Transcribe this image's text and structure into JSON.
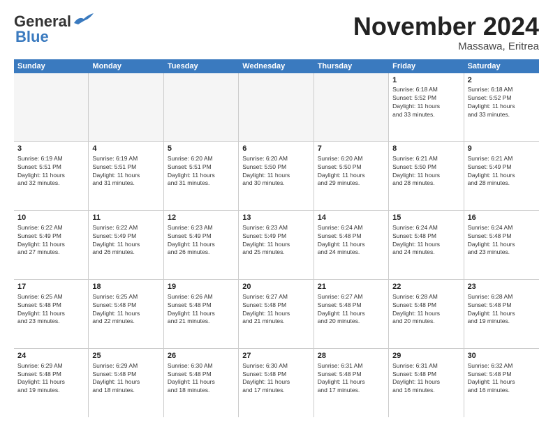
{
  "header": {
    "logo_general": "General",
    "logo_blue": "Blue",
    "month_title": "November 2024",
    "subtitle": "Massawa, Eritrea"
  },
  "days_of_week": [
    "Sunday",
    "Monday",
    "Tuesday",
    "Wednesday",
    "Thursday",
    "Friday",
    "Saturday"
  ],
  "weeks": [
    [
      {
        "day": "",
        "info": "",
        "empty": true
      },
      {
        "day": "",
        "info": "",
        "empty": true
      },
      {
        "day": "",
        "info": "",
        "empty": true
      },
      {
        "day": "",
        "info": "",
        "empty": true
      },
      {
        "day": "",
        "info": "",
        "empty": true
      },
      {
        "day": "1",
        "info": "Sunrise: 6:18 AM\nSunset: 5:52 PM\nDaylight: 11 hours\nand 33 minutes.",
        "empty": false
      },
      {
        "day": "2",
        "info": "Sunrise: 6:18 AM\nSunset: 5:52 PM\nDaylight: 11 hours\nand 33 minutes.",
        "empty": false
      }
    ],
    [
      {
        "day": "3",
        "info": "Sunrise: 6:19 AM\nSunset: 5:51 PM\nDaylight: 11 hours\nand 32 minutes.",
        "empty": false
      },
      {
        "day": "4",
        "info": "Sunrise: 6:19 AM\nSunset: 5:51 PM\nDaylight: 11 hours\nand 31 minutes.",
        "empty": false
      },
      {
        "day": "5",
        "info": "Sunrise: 6:20 AM\nSunset: 5:51 PM\nDaylight: 11 hours\nand 31 minutes.",
        "empty": false
      },
      {
        "day": "6",
        "info": "Sunrise: 6:20 AM\nSunset: 5:50 PM\nDaylight: 11 hours\nand 30 minutes.",
        "empty": false
      },
      {
        "day": "7",
        "info": "Sunrise: 6:20 AM\nSunset: 5:50 PM\nDaylight: 11 hours\nand 29 minutes.",
        "empty": false
      },
      {
        "day": "8",
        "info": "Sunrise: 6:21 AM\nSunset: 5:50 PM\nDaylight: 11 hours\nand 28 minutes.",
        "empty": false
      },
      {
        "day": "9",
        "info": "Sunrise: 6:21 AM\nSunset: 5:49 PM\nDaylight: 11 hours\nand 28 minutes.",
        "empty": false
      }
    ],
    [
      {
        "day": "10",
        "info": "Sunrise: 6:22 AM\nSunset: 5:49 PM\nDaylight: 11 hours\nand 27 minutes.",
        "empty": false
      },
      {
        "day": "11",
        "info": "Sunrise: 6:22 AM\nSunset: 5:49 PM\nDaylight: 11 hours\nand 26 minutes.",
        "empty": false
      },
      {
        "day": "12",
        "info": "Sunrise: 6:23 AM\nSunset: 5:49 PM\nDaylight: 11 hours\nand 26 minutes.",
        "empty": false
      },
      {
        "day": "13",
        "info": "Sunrise: 6:23 AM\nSunset: 5:49 PM\nDaylight: 11 hours\nand 25 minutes.",
        "empty": false
      },
      {
        "day": "14",
        "info": "Sunrise: 6:24 AM\nSunset: 5:48 PM\nDaylight: 11 hours\nand 24 minutes.",
        "empty": false
      },
      {
        "day": "15",
        "info": "Sunrise: 6:24 AM\nSunset: 5:48 PM\nDaylight: 11 hours\nand 24 minutes.",
        "empty": false
      },
      {
        "day": "16",
        "info": "Sunrise: 6:24 AM\nSunset: 5:48 PM\nDaylight: 11 hours\nand 23 minutes.",
        "empty": false
      }
    ],
    [
      {
        "day": "17",
        "info": "Sunrise: 6:25 AM\nSunset: 5:48 PM\nDaylight: 11 hours\nand 23 minutes.",
        "empty": false
      },
      {
        "day": "18",
        "info": "Sunrise: 6:25 AM\nSunset: 5:48 PM\nDaylight: 11 hours\nand 22 minutes.",
        "empty": false
      },
      {
        "day": "19",
        "info": "Sunrise: 6:26 AM\nSunset: 5:48 PM\nDaylight: 11 hours\nand 21 minutes.",
        "empty": false
      },
      {
        "day": "20",
        "info": "Sunrise: 6:27 AM\nSunset: 5:48 PM\nDaylight: 11 hours\nand 21 minutes.",
        "empty": false
      },
      {
        "day": "21",
        "info": "Sunrise: 6:27 AM\nSunset: 5:48 PM\nDaylight: 11 hours\nand 20 minutes.",
        "empty": false
      },
      {
        "day": "22",
        "info": "Sunrise: 6:28 AM\nSunset: 5:48 PM\nDaylight: 11 hours\nand 20 minutes.",
        "empty": false
      },
      {
        "day": "23",
        "info": "Sunrise: 6:28 AM\nSunset: 5:48 PM\nDaylight: 11 hours\nand 19 minutes.",
        "empty": false
      }
    ],
    [
      {
        "day": "24",
        "info": "Sunrise: 6:29 AM\nSunset: 5:48 PM\nDaylight: 11 hours\nand 19 minutes.",
        "empty": false
      },
      {
        "day": "25",
        "info": "Sunrise: 6:29 AM\nSunset: 5:48 PM\nDaylight: 11 hours\nand 18 minutes.",
        "empty": false
      },
      {
        "day": "26",
        "info": "Sunrise: 6:30 AM\nSunset: 5:48 PM\nDaylight: 11 hours\nand 18 minutes.",
        "empty": false
      },
      {
        "day": "27",
        "info": "Sunrise: 6:30 AM\nSunset: 5:48 PM\nDaylight: 11 hours\nand 17 minutes.",
        "empty": false
      },
      {
        "day": "28",
        "info": "Sunrise: 6:31 AM\nSunset: 5:48 PM\nDaylight: 11 hours\nand 17 minutes.",
        "empty": false
      },
      {
        "day": "29",
        "info": "Sunrise: 6:31 AM\nSunset: 5:48 PM\nDaylight: 11 hours\nand 16 minutes.",
        "empty": false
      },
      {
        "day": "30",
        "info": "Sunrise: 6:32 AM\nSunset: 5:48 PM\nDaylight: 11 hours\nand 16 minutes.",
        "empty": false
      }
    ]
  ]
}
